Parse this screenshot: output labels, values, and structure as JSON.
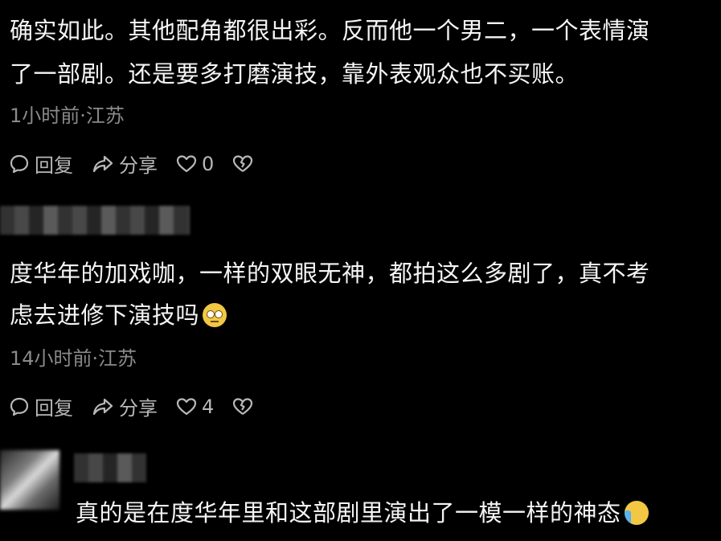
{
  "comments": [
    {
      "line1": "确实如此。其他配角都很出彩。反而他一个男二，一个表情演",
      "line2": "了一部剧。还是要多打磨演技，靠外表观众也不买账。",
      "meta": "1小时前·江苏",
      "reply_label": "回复",
      "share_label": "分享",
      "like_count": "0"
    },
    {
      "line1": "度华年的加戏咖，一样的双眼无神，都拍这么多剧了，真不考",
      "line2": "虑去进修下演技吗",
      "emoji": "face-with-rolling-eyes",
      "meta": "14小时前·江苏",
      "reply_label": "回复",
      "share_label": "分享",
      "like_count": "4"
    },
    {
      "line1": "真的是在度华年里和这部剧里演出了一模一样的神态",
      "emoji": "loudly-crying-face"
    }
  ],
  "colors": {
    "background": "#000000",
    "text": "#f5f5f5",
    "meta": "#8a8a8a",
    "action": "#b8b8b8"
  }
}
